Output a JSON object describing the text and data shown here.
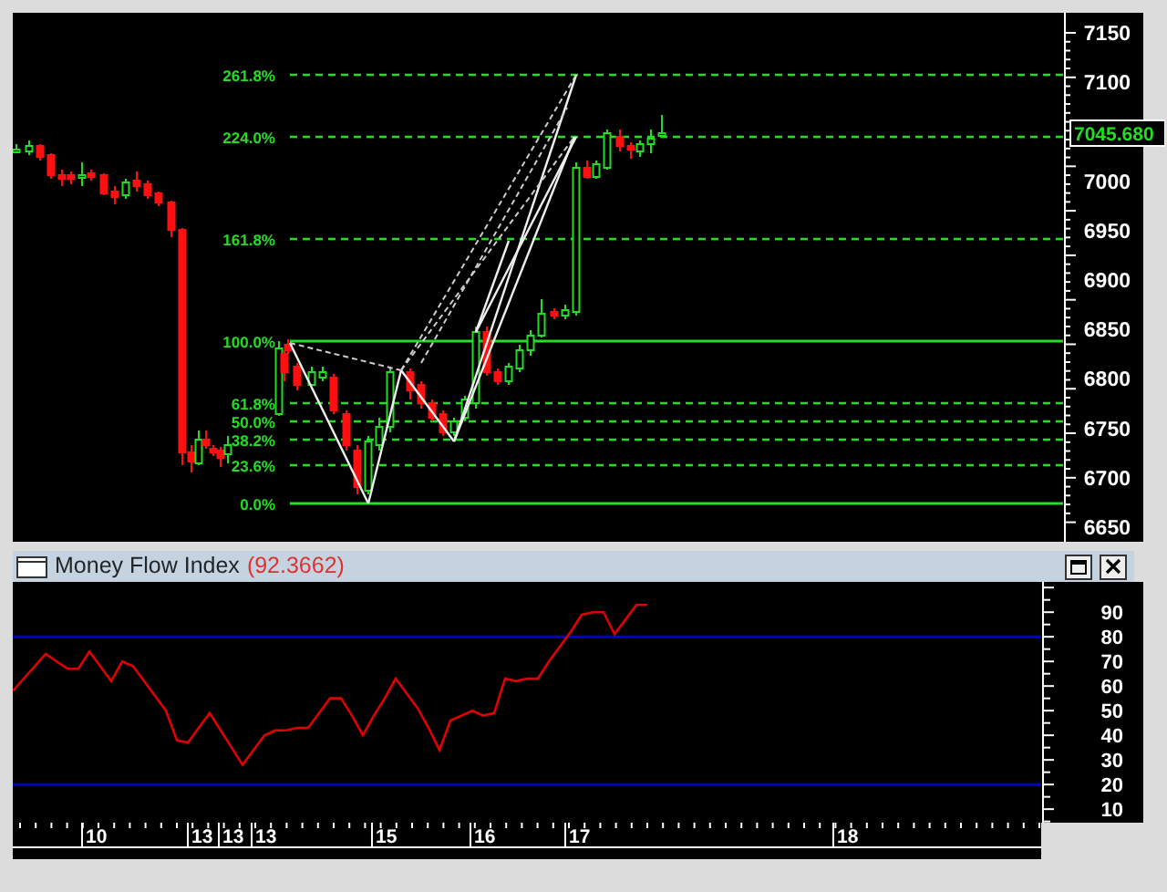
{
  "price_chart": {
    "fib_levels": [
      {
        "label": "261.8%",
        "kind": "dashed"
      },
      {
        "label": "224.0%",
        "kind": "dashed"
      },
      {
        "label": "161.8%",
        "kind": "dashed"
      },
      {
        "label": "100.0%",
        "kind": "solid"
      },
      {
        "label": "61.8%",
        "kind": "dashed"
      },
      {
        "label": "50.0%",
        "kind": "dashed"
      },
      {
        "label": "38.2%",
        "kind": "dashed"
      },
      {
        "label": "23.6%",
        "kind": "dashed"
      },
      {
        "label": "0.0%",
        "kind": "solid"
      }
    ],
    "price_axis": [
      "7150",
      "7100",
      "7000",
      "6950",
      "6900",
      "6850",
      "6800",
      "6750",
      "6700",
      "6650"
    ],
    "last_price": "7045.680"
  },
  "indicator_panel": {
    "value": "(92.3662)",
    "chart_data": {
      "type": "line",
      "categories": [
        null,
        null,
        null,
        null,
        null,
        null,
        null,
        null,
        null,
        null,
        null,
        null,
        null,
        null,
        null,
        null,
        null,
        null,
        null,
        null,
        null,
        null,
        null,
        null,
        null,
        null,
        null,
        null,
        null,
        null,
        null,
        null,
        null,
        null,
        null,
        null,
        null,
        null,
        null,
        null,
        null,
        null,
        null,
        null,
        null,
        null,
        null,
        null,
        null,
        null,
        null,
        null,
        null,
        null,
        null,
        null,
        null,
        null,
        null,
        null,
        null,
        null,
        null,
        null,
        null,
        null,
        null,
        null,
        null,
        null,
        null,
        null,
        null,
        null,
        null,
        null,
        null,
        null,
        null,
        null,
        null,
        null,
        null,
        null,
        null,
        null,
        null,
        null,
        null,
        null,
        null,
        null,
        null,
        null,
        null
      ],
      "series": [
        {
          "name": "Money Flow Index",
          "color": "#e00000",
          "values": [
            58,
            63,
            68,
            73,
            70,
            67,
            67,
            74,
            68,
            62,
            70,
            68,
            62,
            56,
            50,
            38,
            37,
            43,
            49,
            42,
            35,
            28,
            34,
            40,
            42,
            42,
            43,
            43,
            49,
            55,
            55,
            48,
            40,
            48,
            55,
            63,
            57,
            51,
            43,
            34,
            46,
            48,
            50,
            48,
            49,
            63,
            62,
            63,
            63,
            70,
            76,
            82,
            89,
            90,
            90,
            81,
            87,
            93,
            93,
            null,
            null,
            null,
            null,
            null,
            null,
            null,
            null,
            null,
            null,
            null,
            null,
            null,
            null,
            null,
            null,
            null,
            null,
            null,
            null,
            null,
            null,
            null,
            null,
            null,
            null,
            null,
            null,
            null,
            null,
            null,
            null,
            null,
            null,
            null,
            null
          ]
        }
      ],
      "ylim": [
        4.5,
        102.3
      ],
      "yticks": [
        {
          "value": 10,
          "label": "10"
        },
        {
          "value": 20,
          "label": "20"
        },
        {
          "value": 30,
          "label": "30"
        },
        {
          "value": 40,
          "label": "40"
        },
        {
          "value": 50,
          "label": "50"
        },
        {
          "value": 60,
          "label": "60"
        },
        {
          "value": 70,
          "label": "70"
        },
        {
          "value": 80,
          "label": "80"
        },
        {
          "value": 90,
          "label": "90"
        }
      ]
    }
  },
  "time_axis": [
    "10",
    "13",
    "13",
    "13",
    "15",
    "16",
    "17",
    "18"
  ]
}
